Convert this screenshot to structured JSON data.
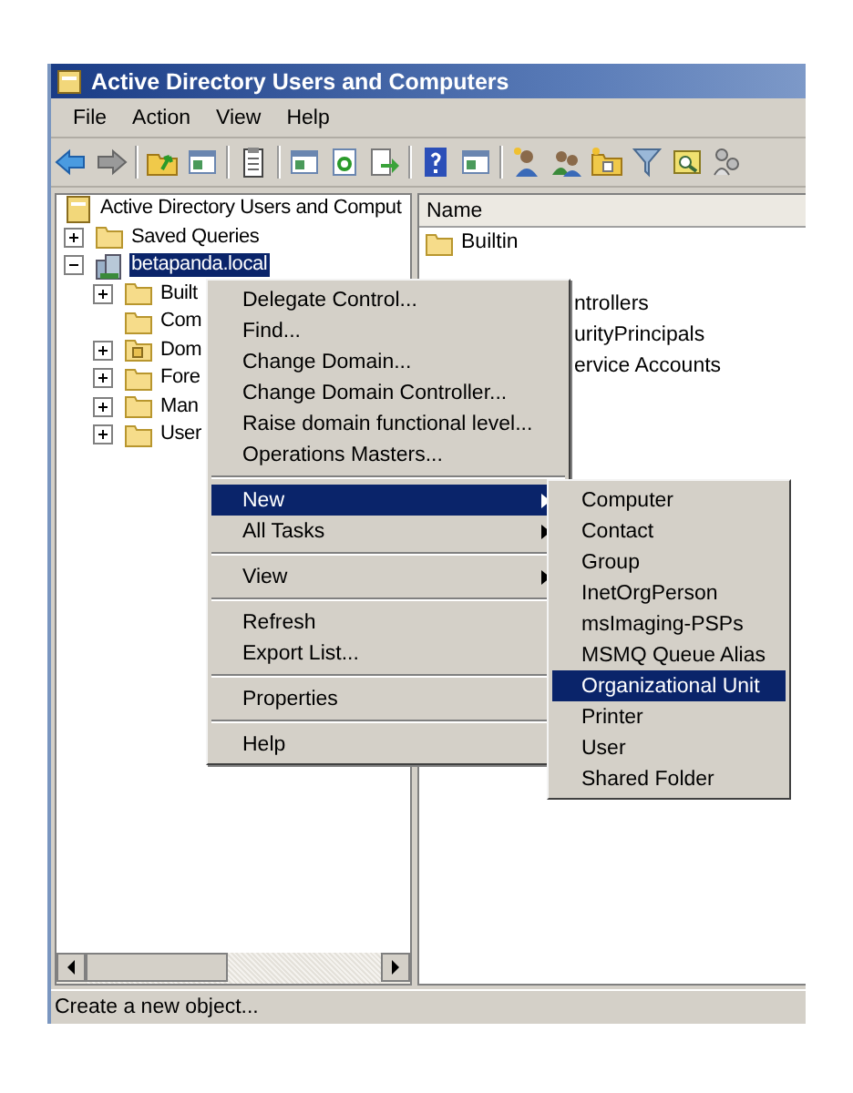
{
  "window": {
    "title": "Active Directory Users and Computers"
  },
  "menu_bar": [
    "File",
    "Action",
    "View",
    "Help"
  ],
  "tree": {
    "root": "Active Directory Users and Comput",
    "items": [
      {
        "label": "Saved Queries",
        "kind": "folder",
        "expandable": true,
        "expanded": false,
        "selected": false
      },
      {
        "label": "betapanda.local",
        "kind": "domain",
        "expandable": true,
        "expanded": true,
        "selected": true,
        "children": [
          {
            "label": "Built",
            "kind": "folder",
            "expandable": true,
            "expanded": false,
            "selected": false
          },
          {
            "label": "Com",
            "kind": "folder",
            "expandable": false,
            "expanded": false,
            "selected": false
          },
          {
            "label": "Dom",
            "kind": "ou",
            "expandable": true,
            "expanded": false,
            "selected": false
          },
          {
            "label": "Fore",
            "kind": "folder",
            "expandable": true,
            "expanded": false,
            "selected": false
          },
          {
            "label": "Man",
            "kind": "folder",
            "expandable": true,
            "expanded": false,
            "selected": false
          },
          {
            "label": "User",
            "kind": "folder",
            "expandable": true,
            "expanded": false,
            "selected": false
          }
        ]
      }
    ]
  },
  "list": {
    "columns": [
      "Name"
    ],
    "rows": [
      {
        "name": "Builtin",
        "kind": "folder"
      },
      {
        "name": "",
        "kind": "hidden"
      },
      {
        "name": "ntrollers",
        "kind": "covered"
      },
      {
        "name": "urityPrincipals",
        "kind": "covered"
      },
      {
        "name": "ervice Accounts",
        "kind": "covered"
      }
    ]
  },
  "context_menu": [
    {
      "kind": "item",
      "label": "Delegate Control...",
      "submenu": false,
      "selected": false
    },
    {
      "kind": "item",
      "label": "Find...",
      "submenu": false,
      "selected": false
    },
    {
      "kind": "item",
      "label": "Change Domain...",
      "submenu": false,
      "selected": false
    },
    {
      "kind": "item",
      "label": "Change Domain Controller...",
      "submenu": false,
      "selected": false
    },
    {
      "kind": "item",
      "label": "Raise domain functional level...",
      "submenu": false,
      "selected": false
    },
    {
      "kind": "item",
      "label": "Operations Masters...",
      "submenu": false,
      "selected": false
    },
    {
      "kind": "separator"
    },
    {
      "kind": "item",
      "label": "New",
      "submenu": true,
      "selected": true
    },
    {
      "kind": "item",
      "label": "All Tasks",
      "submenu": true,
      "selected": false
    },
    {
      "kind": "separator"
    },
    {
      "kind": "item",
      "label": "View",
      "submenu": true,
      "selected": false
    },
    {
      "kind": "separator"
    },
    {
      "kind": "item",
      "label": "Refresh",
      "submenu": false,
      "selected": false
    },
    {
      "kind": "item",
      "label": "Export List...",
      "submenu": false,
      "selected": false
    },
    {
      "kind": "separator"
    },
    {
      "kind": "item",
      "label": "Properties",
      "submenu": false,
      "selected": false
    },
    {
      "kind": "separator"
    },
    {
      "kind": "item",
      "label": "Help",
      "submenu": false,
      "selected": false
    }
  ],
  "submenu": [
    {
      "label": "Computer",
      "selected": false
    },
    {
      "label": "Contact",
      "selected": false
    },
    {
      "label": "Group",
      "selected": false
    },
    {
      "label": "InetOrgPerson",
      "selected": false
    },
    {
      "label": "msImaging-PSPs",
      "selected": false
    },
    {
      "label": "MSMQ Queue Alias",
      "selected": false
    },
    {
      "label": "Organizational Unit",
      "selected": true
    },
    {
      "label": "Printer",
      "selected": false
    },
    {
      "label": "User",
      "selected": false
    },
    {
      "label": "Shared Folder",
      "selected": false
    }
  ],
  "status_bar": "Create a new object..."
}
